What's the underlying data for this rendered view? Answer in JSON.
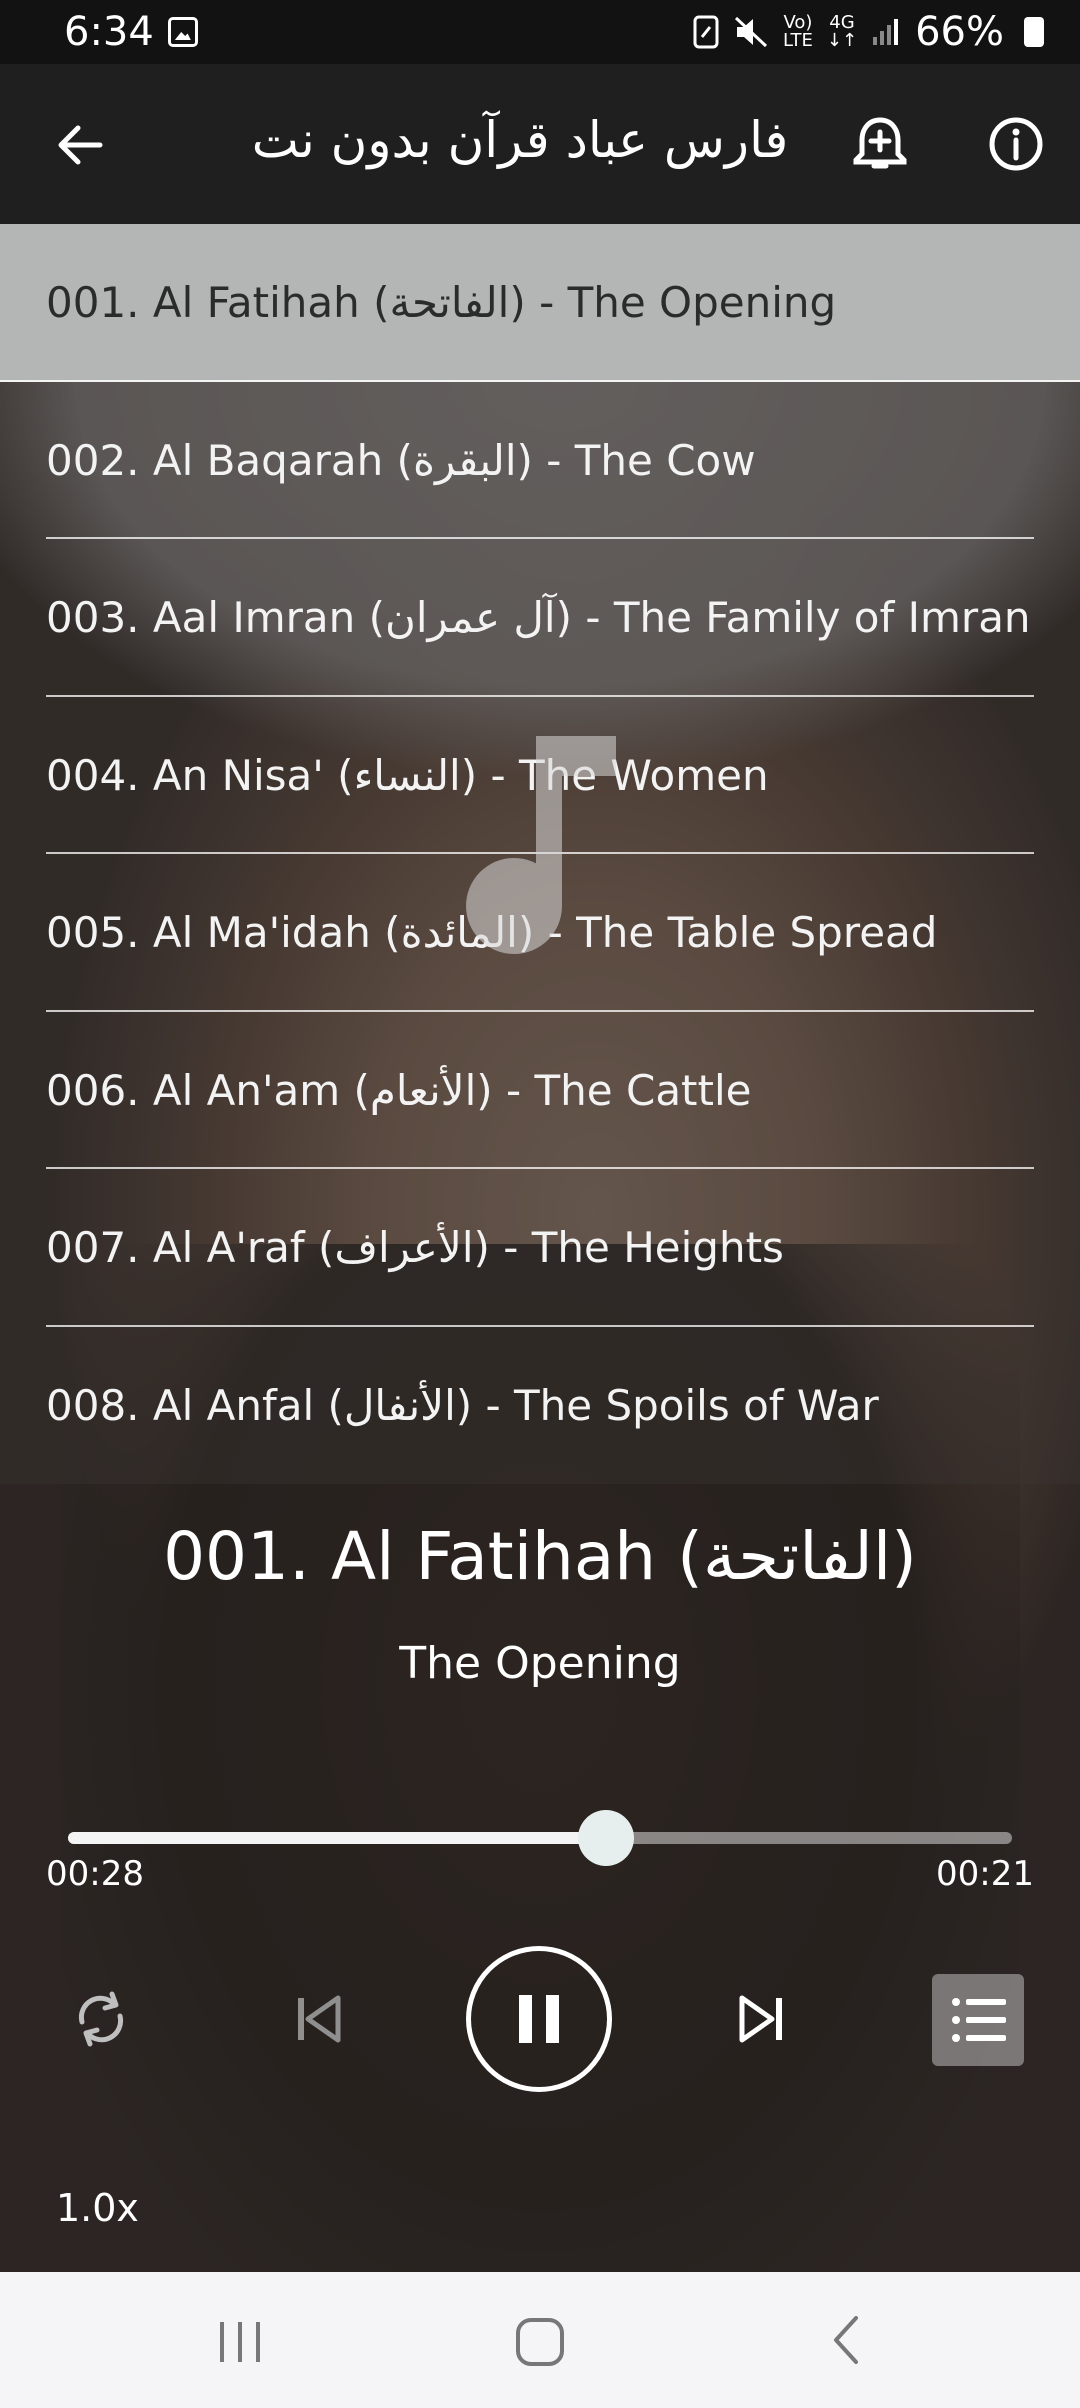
{
  "status_bar": {
    "time": "6:34",
    "network_volte": "Vo)",
    "network_lte": "LTE",
    "network_gen": "4G",
    "battery": "66%"
  },
  "app_bar": {
    "title": "فارس عباد قرآن بدون نت"
  },
  "playlist": [
    {
      "label": "001. Al Fatihah (الفاتحة) - The Opening",
      "selected": true
    },
    {
      "label": "002. Al Baqarah (البقرة) - The Cow",
      "selected": false
    },
    {
      "label": "003. Aal Imran (آل عمران) - The Family of Imran",
      "selected": false
    },
    {
      "label": "004. An Nisa' (النساء) - The Women",
      "selected": false
    },
    {
      "label": "005. Al Ma'idah (المائدة) - The Table Spread",
      "selected": false
    },
    {
      "label": "006. Al An'am (الأنعام) - The Cattle",
      "selected": false
    },
    {
      "label": "007. Al A'raf (الأعراف) - The Heights",
      "selected": false
    },
    {
      "label": "008. Al Anfal (الأنفال) - The Spoils of War",
      "selected": false
    }
  ],
  "now_playing": {
    "title": "001. Al Fatihah (الفاتحة)",
    "subtitle": "The Opening",
    "elapsed": "00:28",
    "remaining": "00:21",
    "progress": 0.57,
    "speed": "1.0x"
  },
  "controls": {
    "repeat_icon": "repeat-icon",
    "previous_icon": "skip-previous-icon",
    "play_pause_icon": "pause-icon",
    "next_icon": "skip-next-icon",
    "queue_icon": "queue-list-icon"
  },
  "colors": {
    "app_bar_bg": "#1f1f1f",
    "selected_row_bg": "#b3b6b4",
    "nav_bar_bg": "#f5f5f7"
  }
}
